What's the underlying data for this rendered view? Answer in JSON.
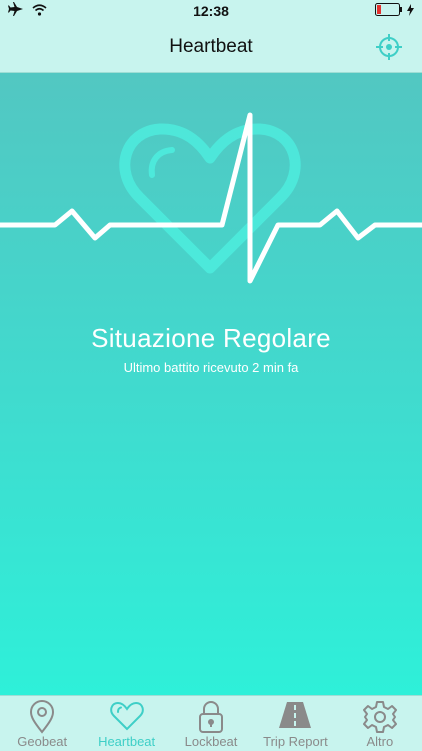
{
  "status_bar": {
    "time": "12:38",
    "icons": [
      "airplane-icon",
      "wifi-icon",
      "battery-icon",
      "charging-icon"
    ]
  },
  "nav": {
    "title": "Heartbeat",
    "right_icon": "crosshair-target-icon"
  },
  "main": {
    "status_title": "Situazione Regolare",
    "status_subtitle": "Ultimo battito ricevuto 2 min fa"
  },
  "tabs": [
    {
      "label": "Geobeat",
      "icon": "location-pin-icon",
      "active": false
    },
    {
      "label": "Heartbeat",
      "icon": "heart-icon",
      "active": true
    },
    {
      "label": "Lockbeat",
      "icon": "padlock-icon",
      "active": false
    },
    {
      "label": "Trip Report",
      "icon": "road-icon",
      "active": false
    },
    {
      "label": "Altro",
      "icon": "gear-icon",
      "active": false
    }
  ],
  "colors": {
    "accent": "#3ecfc7",
    "bar_background": "#c8f4ee",
    "gradient_top": "#52c7c2",
    "gradient_bottom": "#2ef0d9",
    "tab_inactive": "#8a8a8a"
  }
}
